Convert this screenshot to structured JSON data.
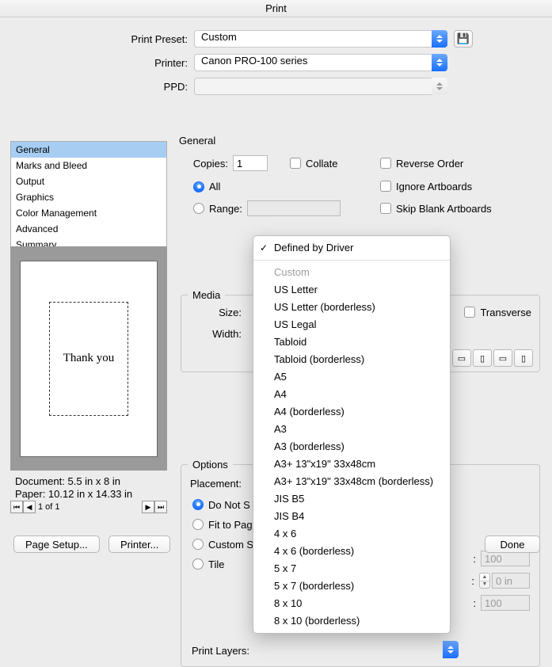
{
  "window": {
    "title": "Print"
  },
  "header": {
    "preset_label": "Print Preset:",
    "preset_value": "Custom",
    "printer_label": "Printer:",
    "printer_value": "Canon PRO-100 series",
    "ppd_label": "PPD:",
    "ppd_value": ""
  },
  "sidebar": {
    "items": [
      "General",
      "Marks and Bleed",
      "Output",
      "Graphics",
      "Color Management",
      "Advanced",
      "Summary"
    ],
    "selected": 0
  },
  "preview": {
    "artwork_text": "Thank you",
    "doc_label": "Document: 5.5 in x 8 in",
    "paper_label": "Paper: 10.12 in x 14.33 in",
    "page_label": "1 of 1"
  },
  "general": {
    "section": "General",
    "copies_label": "Copies:",
    "copies_value": "1",
    "collate": "Collate",
    "reverse": "Reverse Order",
    "all": "All",
    "ignore": "Ignore Artboards",
    "range": "Range:",
    "range_value": "",
    "skip": "Skip Blank Artboards"
  },
  "media": {
    "legend": "Media",
    "size_label": "Size:",
    "size_value": "Defined by Driver",
    "transverse": "Transverse",
    "width_label": "Width:",
    "options": [
      {
        "label": "Defined by Driver",
        "checked": true
      },
      null,
      {
        "label": "Custom",
        "disabled": true
      },
      {
        "label": "US Letter"
      },
      {
        "label": "US Letter (borderless)"
      },
      {
        "label": "US Legal"
      },
      {
        "label": "Tabloid"
      },
      {
        "label": "Tabloid (borderless)"
      },
      {
        "label": "A5"
      },
      {
        "label": "A4"
      },
      {
        "label": "A4 (borderless)"
      },
      {
        "label": "A3"
      },
      {
        "label": "A3 (borderless)"
      },
      {
        "label": "A3+ 13\"x19\" 33x48cm"
      },
      {
        "label": "A3+ 13\"x19\" 33x48cm (borderless)"
      },
      {
        "label": "JIS B5"
      },
      {
        "label": "JIS B4"
      },
      {
        "label": "4 x 6"
      },
      {
        "label": "4 x 6 (borderless)"
      },
      {
        "label": "5 x 7"
      },
      {
        "label": "5 x 7 (borderless)"
      },
      {
        "label": "8 x 10"
      },
      {
        "label": "8 x 10 (borderless)"
      }
    ]
  },
  "options": {
    "legend": "Options",
    "placement_label": "Placement:",
    "do_not_scale": "Do Not S",
    "fit": "Fit to Pag",
    "custom": "Custom S",
    "tile": "Tile",
    "right_col": {
      "val1": "100",
      "unit2": "0 in",
      "val3": "100"
    },
    "print_layers_label": "Print Layers:"
  },
  "footer": {
    "page_setup": "Page Setup...",
    "printer": "Printer...",
    "done": "Done"
  }
}
